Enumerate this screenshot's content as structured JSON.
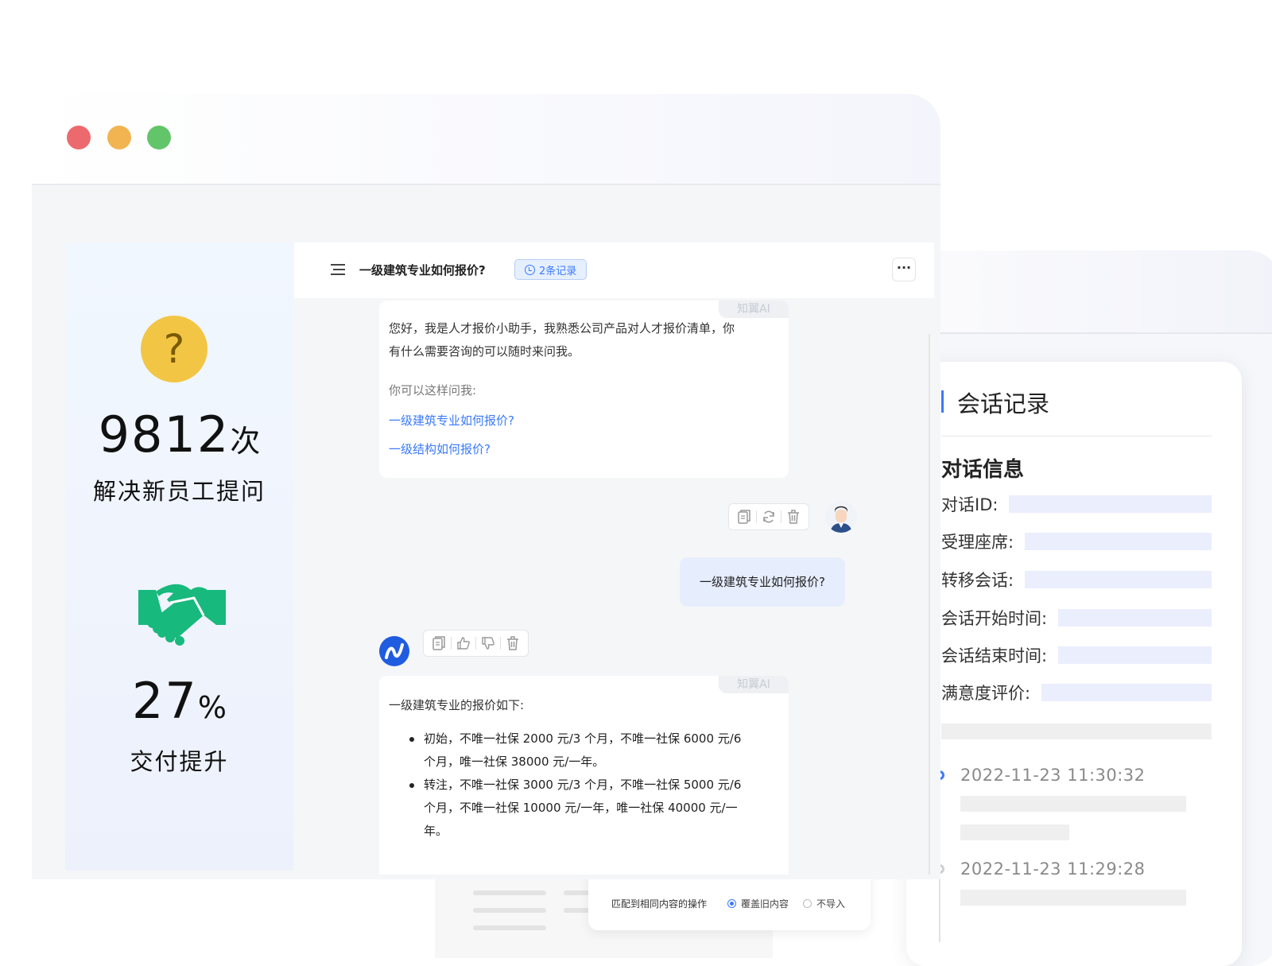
{
  "colors": {
    "accent": "#3a7afe",
    "traffic_red": "#ec6a6e",
    "traffic_yellow": "#f2b451",
    "traffic_green": "#63c56a",
    "brand_green": "#18b97c",
    "question_yellow": "#f2c644"
  },
  "stats": {
    "questions": {
      "icon": "question-icon",
      "value": "9812",
      "unit": "次",
      "label": "解决新员工提问"
    },
    "delivery": {
      "icon": "handshake-icon",
      "value": "27",
      "unit": "%",
      "label": "交付提升"
    }
  },
  "chat": {
    "title": "一级建筑专业如何报价?",
    "record_tag": "2条记录",
    "more_label": "···",
    "ai_badge": "知翼AI",
    "greeting": {
      "line1": "您好，我是人才报价小助手，我熟悉公司产品对人才报价清单，你",
      "line2": "有什么需要咨询的可以随时来问我。",
      "hint": "你可以这样问我:",
      "suggestions": [
        "一级建筑专业如何报价?",
        "一级结构如何报价?"
      ]
    },
    "user_message": "一级建筑专业如何报价?",
    "answer": {
      "intro": "一级建筑专业的报价如下:",
      "items": [
        {
          "line1": "初始，不唯一社保 2000 元/3 个月，不唯一社保 6000 元/6",
          "line2": "个月，唯一社保 38000 元/一年。"
        },
        {
          "line1": "转注，不唯一社保 3000 元/3 个月，不唯一社保 5000 元/6",
          "line2": "个月，不唯一社保 10000 元/一年，唯一社保 40000 元/一",
          "line3": "年。"
        }
      ]
    }
  },
  "record_panel": {
    "title": "会话记录",
    "info_heading": "对话信息",
    "fields": [
      "对话ID:",
      "受理座席:",
      "转移会话:",
      "会话开始时间:",
      "会话结束时间:",
      "满意度评价:"
    ],
    "timeline": [
      "2022-11-23  11:30:32",
      "2022-11-23  11:29:28"
    ]
  },
  "import_options": {
    "label": "匹配到相同内容的操作",
    "options": [
      {
        "label": "覆盖旧内容",
        "selected": true
      },
      {
        "label": "不导入",
        "selected": false
      }
    ]
  }
}
